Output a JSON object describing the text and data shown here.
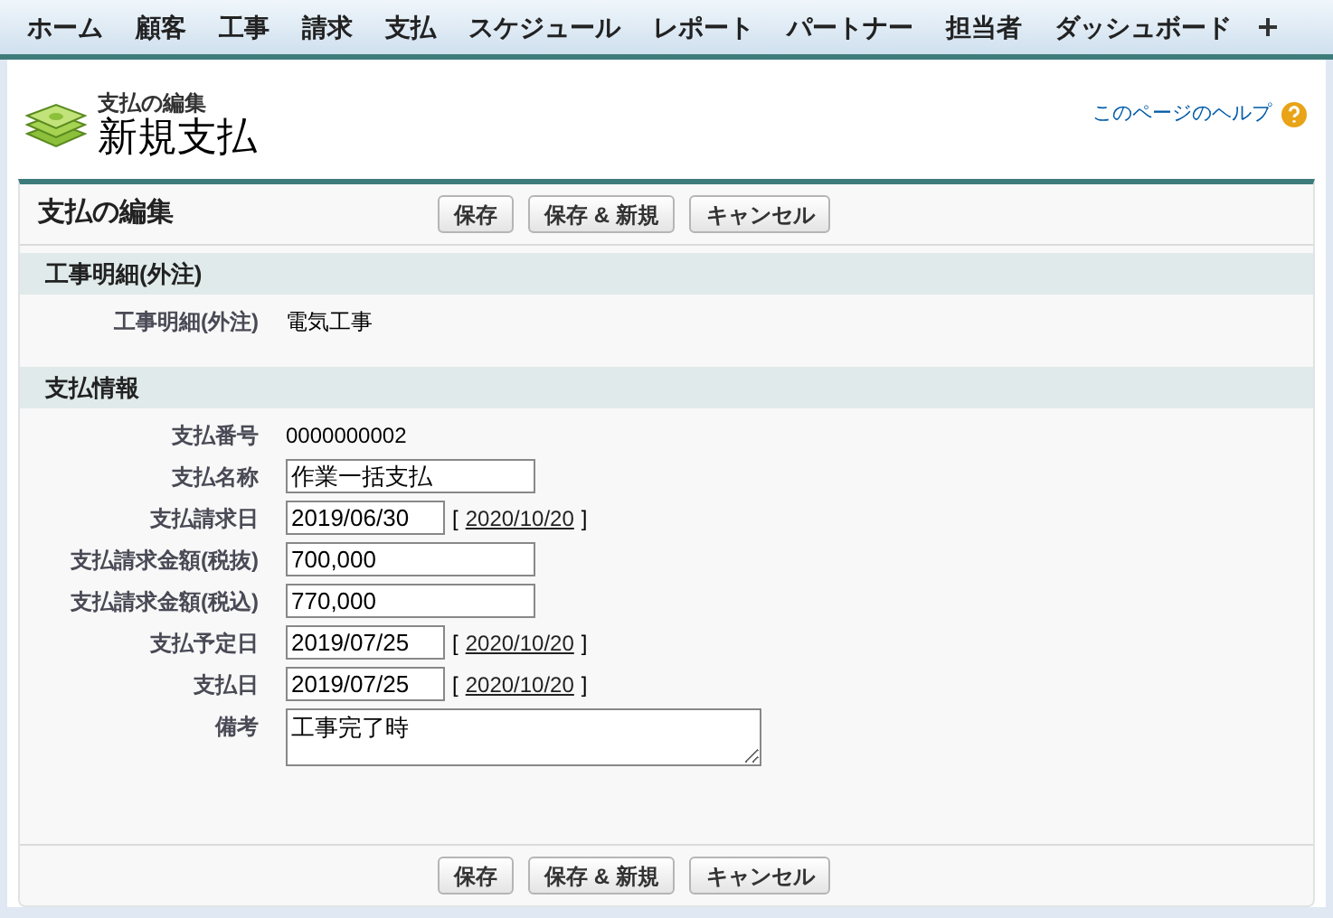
{
  "tabs": [
    {
      "label": "ホーム",
      "selected": false
    },
    {
      "label": "顧客",
      "selected": false
    },
    {
      "label": "工事",
      "selected": false
    },
    {
      "label": "請求",
      "selected": false
    },
    {
      "label": "支払",
      "selected": false
    },
    {
      "label": "スケジュール",
      "selected": false
    },
    {
      "label": "レポート",
      "selected": false
    },
    {
      "label": "パートナー",
      "selected": false
    },
    {
      "label": "担当者",
      "selected": false
    },
    {
      "label": "ダッシュボード",
      "selected": false
    }
  ],
  "page_header": {
    "subtitle": "支払の編集",
    "title": "新規支払",
    "help_link": "このページのヘルプ"
  },
  "panel": {
    "title": "支払の編集",
    "buttons": [
      "保存",
      "保存 & 新規",
      "キャンセル"
    ],
    "sections": [
      {
        "title": "工事明細(外注)",
        "fields": [
          {
            "kind": "text",
            "label": "工事明細(外注)",
            "value": "電気工事"
          }
        ]
      },
      {
        "title": "支払情報",
        "fields": [
          {
            "kind": "text",
            "label": "支払番号",
            "value": "0000000002"
          },
          {
            "kind": "input",
            "label": "支払名称",
            "value": "作業一括支払"
          },
          {
            "kind": "date",
            "label": "支払請求日",
            "value": "2019/06/30",
            "open": "[",
            "today": "2020/10/20",
            "close": "]"
          },
          {
            "kind": "input",
            "label": "支払請求金額(税抜)",
            "value": "700,000"
          },
          {
            "kind": "input",
            "label": "支払請求金額(税込)",
            "value": "770,000"
          },
          {
            "kind": "date",
            "label": "支払予定日",
            "value": "2019/07/25",
            "open": "[",
            "today": "2020/10/20",
            "close": "]"
          },
          {
            "kind": "date",
            "label": "支払日",
            "value": "2019/07/25",
            "open": "[",
            "today": "2020/10/20",
            "close": "]"
          },
          {
            "kind": "textarea",
            "label": "備考",
            "value": "工事完了時"
          }
        ]
      }
    ],
    "bottom_buttons": [
      "保存",
      "保存 & 新規",
      "キャンセル"
    ]
  }
}
